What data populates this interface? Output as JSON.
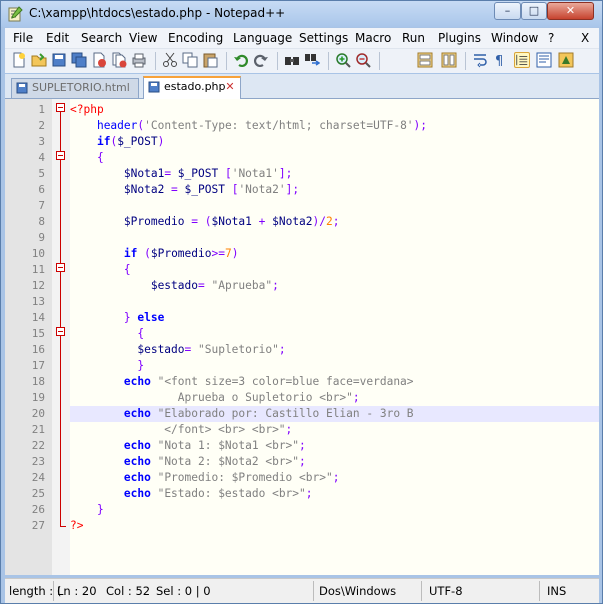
{
  "window": {
    "title": "C:\\xampp\\htdocs\\estado.php - Notepad++",
    "min_glyph": "–",
    "max_glyph": "□",
    "close_glyph": "✕"
  },
  "menu": [
    "File",
    "Edit",
    "Search",
    "View",
    "Encoding",
    "Language",
    "Settings",
    "Macro",
    "Run",
    "Plugins",
    "Window",
    "?",
    "X"
  ],
  "tabs": [
    {
      "label": "SUPLETORIO.html",
      "active": false,
      "close": "✕"
    },
    {
      "label": "estado.php",
      "active": true,
      "close": "✕"
    }
  ],
  "editor": {
    "current_line": 20,
    "lines": [
      [
        [
          "php",
          "<?php"
        ]
      ],
      [
        [
          "sp",
          "    "
        ],
        [
          "fn",
          "header"
        ],
        [
          "op",
          "("
        ],
        [
          "str",
          "'Content-Type: text/html; charset=UTF-8'"
        ],
        [
          "op",
          ");"
        ]
      ],
      [
        [
          "sp",
          "    "
        ],
        [
          "kw",
          "if"
        ],
        [
          "op",
          "("
        ],
        [
          "var",
          "$_POST"
        ],
        [
          "op",
          ")"
        ]
      ],
      [
        [
          "sp",
          "    "
        ],
        [
          "op",
          "{"
        ]
      ],
      [
        [
          "sp",
          "        "
        ],
        [
          "var",
          "$Nota1"
        ],
        [
          "op",
          "= "
        ],
        [
          "var",
          "$_POST"
        ],
        [
          "op",
          " ["
        ],
        [
          "str",
          "'Nota1'"
        ],
        [
          "op",
          "];"
        ]
      ],
      [
        [
          "sp",
          "        "
        ],
        [
          "var",
          "$Nota2"
        ],
        [
          "op",
          " = "
        ],
        [
          "var",
          "$_POST"
        ],
        [
          "op",
          " ["
        ],
        [
          "str",
          "'Nota2'"
        ],
        [
          "op",
          "];"
        ]
      ],
      [],
      [
        [
          "sp",
          "        "
        ],
        [
          "var",
          "$Promedio"
        ],
        [
          "op",
          " = ("
        ],
        [
          "var",
          "$Nota1"
        ],
        [
          "op",
          " + "
        ],
        [
          "var",
          "$Nota2"
        ],
        [
          "op",
          ")/"
        ],
        [
          "num",
          "2"
        ],
        [
          "op",
          ";"
        ]
      ],
      [],
      [
        [
          "sp",
          "        "
        ],
        [
          "kw",
          "if"
        ],
        [
          "op",
          " ("
        ],
        [
          "var",
          "$Promedio"
        ],
        [
          "op",
          ">="
        ],
        [
          "num",
          "7"
        ],
        [
          "op",
          ")"
        ]
      ],
      [
        [
          "sp",
          "        "
        ],
        [
          "op",
          "{"
        ]
      ],
      [
        [
          "sp",
          "            "
        ],
        [
          "var",
          "$estado"
        ],
        [
          "op",
          "= "
        ],
        [
          "str",
          "\"Aprueba\""
        ],
        [
          "op",
          ";"
        ]
      ],
      [],
      [
        [
          "sp",
          "        "
        ],
        [
          "op",
          "} "
        ],
        [
          "kw",
          "else"
        ]
      ],
      [
        [
          "sp",
          "          "
        ],
        [
          "op",
          "{"
        ]
      ],
      [
        [
          "sp",
          "          "
        ],
        [
          "var",
          "$estado"
        ],
        [
          "op",
          "= "
        ],
        [
          "str",
          "\"Supletorio\""
        ],
        [
          "op",
          ";"
        ]
      ],
      [
        [
          "sp",
          "          "
        ],
        [
          "op",
          "}"
        ]
      ],
      [
        [
          "sp",
          "        "
        ],
        [
          "kw",
          "echo"
        ],
        [
          "str",
          " \"<font size=3 color=blue face=verdana>"
        ]
      ],
      [
        [
          "str",
          "                Aprueba o Supletorio <br>\""
        ],
        [
          "op",
          ";"
        ]
      ],
      [
        [
          "sp",
          "        "
        ],
        [
          "kw",
          "echo"
        ],
        [
          "str",
          " \"Elaborado por: Castillo Elian - 3ro B"
        ]
      ],
      [
        [
          "str",
          "              </font> <br> <br>\""
        ],
        [
          "op",
          ";"
        ]
      ],
      [
        [
          "sp",
          "        "
        ],
        [
          "kw",
          "echo"
        ],
        [
          "str",
          " \"Nota 1: $Nota1 <br>\""
        ],
        [
          "op",
          ";"
        ]
      ],
      [
        [
          "sp",
          "        "
        ],
        [
          "kw",
          "echo"
        ],
        [
          "str",
          " \"Nota 2: $Nota2 <br>\""
        ],
        [
          "op",
          ";"
        ]
      ],
      [
        [
          "sp",
          "        "
        ],
        [
          "kw",
          "echo"
        ],
        [
          "str",
          " \"Promedio: $Promedio <br>\""
        ],
        [
          "op",
          ";"
        ]
      ],
      [
        [
          "sp",
          "        "
        ],
        [
          "kw",
          "echo"
        ],
        [
          "str",
          " \"Estado: $estado <br>\""
        ],
        [
          "op",
          ";"
        ]
      ],
      [
        [
          "sp",
          "    "
        ],
        [
          "op",
          "}"
        ]
      ],
      [
        [
          "php",
          "?>"
        ]
      ]
    ]
  },
  "status": {
    "length": "length : (",
    "ln": "Ln : 20",
    "col": "Col : 52",
    "sel": "Sel : 0 | 0",
    "eol": "Dos\\Windows",
    "encoding": "UTF-8",
    "mode": "INS"
  },
  "colors": {
    "keyword": "#0000ff",
    "string": "#808080",
    "operator": "#8000ff",
    "php_tag": "#ff0000",
    "number": "#ff8000",
    "current_line": "#e8e8ff"
  },
  "toolbar_icons": [
    "new-file-icon",
    "open-file-icon",
    "save-icon",
    "save-all-icon",
    "close-icon",
    "close-all-icon",
    "print-icon",
    "cut-icon",
    "copy-icon",
    "paste-icon",
    "undo-icon",
    "redo-icon",
    "find-icon",
    "replace-icon",
    "zoom-in-icon",
    "zoom-out-icon",
    "sync-vertical-icon",
    "sync-horizontal-icon",
    "word-wrap-icon",
    "show-all-chars-icon",
    "indent-guide-icon",
    "document-map-icon",
    "function-list-icon"
  ]
}
